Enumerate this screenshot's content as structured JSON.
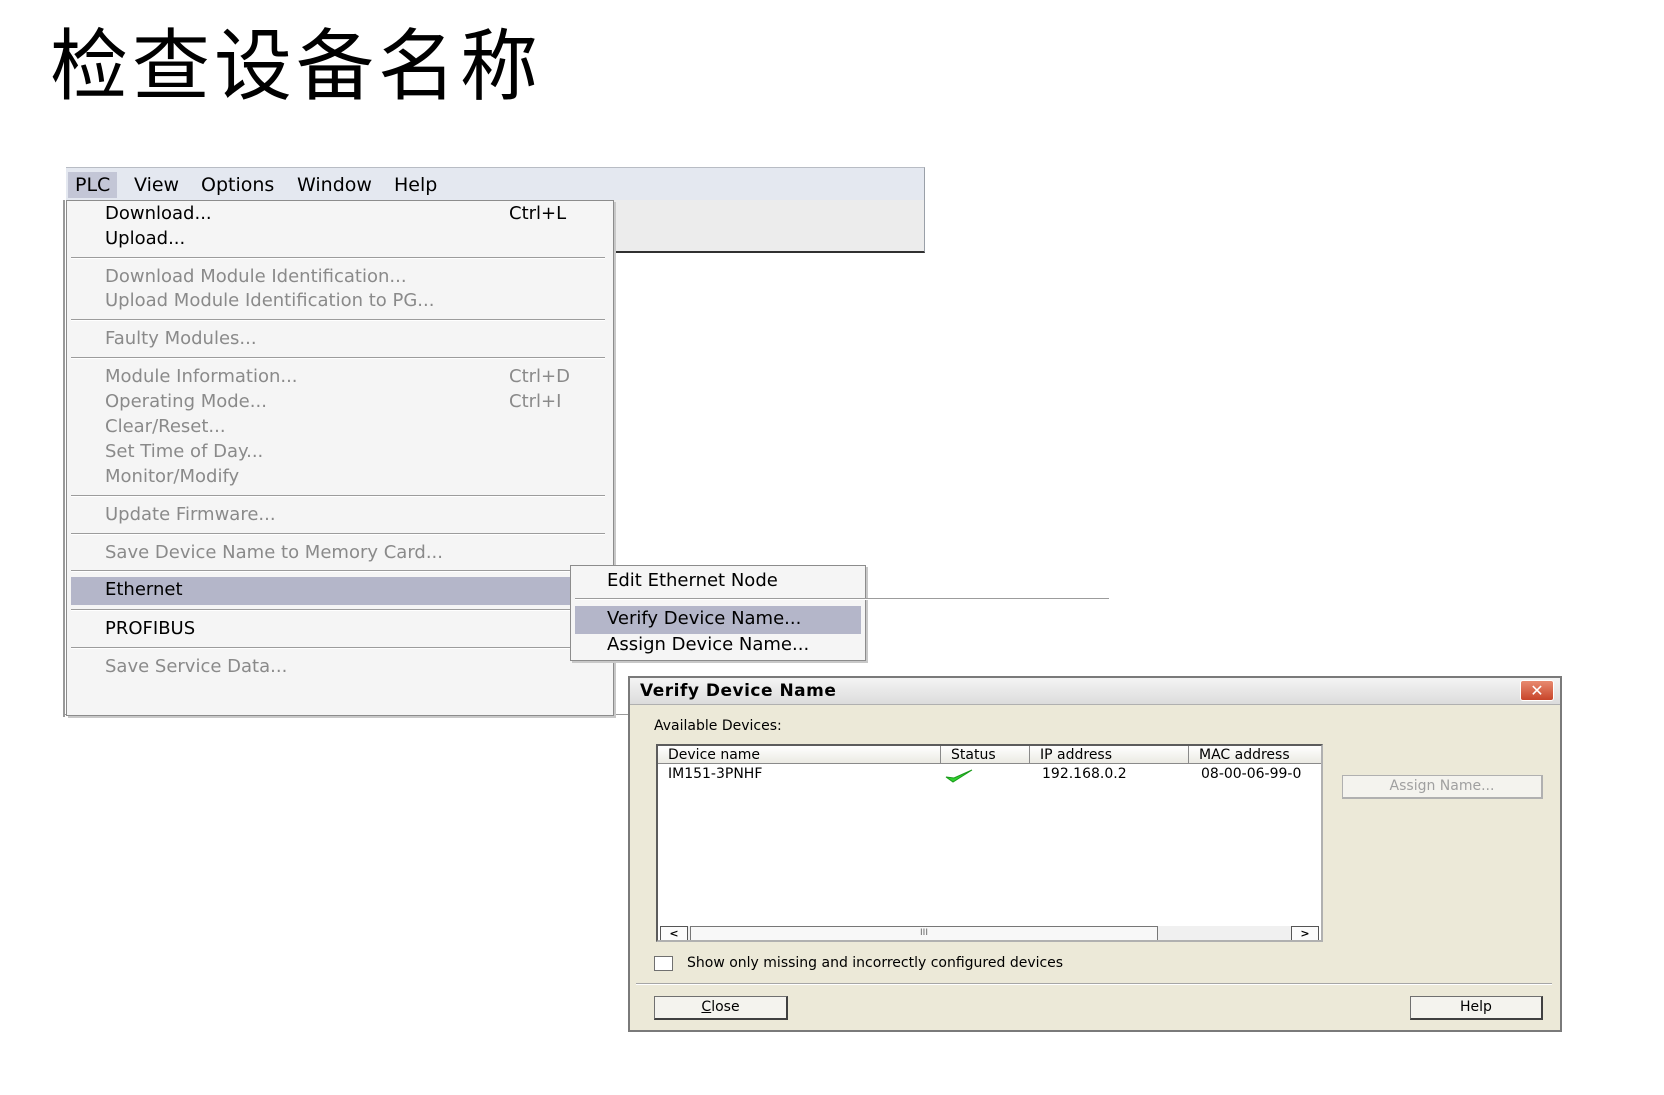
{
  "slide": {
    "title": "检查设备名称"
  },
  "menubar": {
    "items": [
      {
        "label": "PLC"
      },
      {
        "label": "View"
      },
      {
        "label": "Options"
      },
      {
        "label": "Window"
      },
      {
        "label": "Help"
      }
    ]
  },
  "plc_menu": {
    "download": {
      "label": "Download...",
      "shortcut": "Ctrl+L"
    },
    "upload": {
      "label": "Upload..."
    },
    "download_module_id": {
      "label": "Download Module Identification..."
    },
    "upload_module_id": {
      "label": "Upload Module Identification to PG..."
    },
    "faulty_modules": {
      "label": "Faulty Modules..."
    },
    "module_information": {
      "label": "Module Information...",
      "shortcut": "Ctrl+D"
    },
    "operating_mode": {
      "label": "Operating Mode...",
      "shortcut": "Ctrl+I"
    },
    "clear_reset": {
      "label": "Clear/Reset..."
    },
    "set_time_of_day": {
      "label": "Set Time of Day..."
    },
    "monitor_modify": {
      "label": "Monitor/Modify"
    },
    "update_firmware": {
      "label": "Update Firmware..."
    },
    "save_device_name": {
      "label": "Save Device Name to Memory Card..."
    },
    "ethernet": {
      "label": "Ethernet"
    },
    "profibus": {
      "label": "PROFIBUS"
    },
    "save_service_data": {
      "label": "Save Service Data..."
    }
  },
  "ethernet_submenu": {
    "edit_node": {
      "label": "Edit Ethernet Node"
    },
    "verify_name": {
      "label": "Verify Device Name..."
    },
    "assign_name": {
      "label": "Assign Device Name..."
    }
  },
  "dialog": {
    "title": "Verify Device Name",
    "close_glyph": "✕",
    "available_label": "Available Devices:",
    "columns": {
      "device_name": "Device name",
      "status": "Status",
      "ip_address": "IP address",
      "mac_address": "MAC address"
    },
    "rows": [
      {
        "device_name": "IM151-3PNHF",
        "status_icon": "green-check-icon",
        "ip_address": "192.168.0.2",
        "mac_address": "08-00-06-99-0"
      }
    ],
    "scroll_left": "<",
    "scroll_right": ">",
    "scroll_grip": "III",
    "assign_button": "Assign Name...",
    "checkbox_label": "Show only missing and incorrectly configured devices",
    "close_button": {
      "mnemonic": "C",
      "rest": "lose"
    },
    "help_button": "Help",
    "colors": {
      "check": "#2fd12f",
      "menu_highlight": "#b4b6c9"
    }
  }
}
